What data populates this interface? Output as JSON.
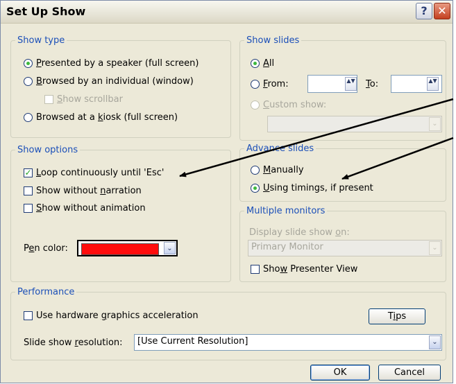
{
  "window": {
    "title": "Set Up Show",
    "help_glyph": "?",
    "close_glyph": "✕"
  },
  "show_type": {
    "legend": "Show type",
    "speaker": {
      "pre": "",
      "u": "P",
      "post": "resented by a speaker (full screen)"
    },
    "individual": {
      "pre": "",
      "u": "B",
      "post": "rowsed by an individual (window)"
    },
    "scrollbar": {
      "pre": "",
      "u": "S",
      "post": "how scrollbar"
    },
    "kiosk": {
      "pre": "Browsed at a ",
      "u": "k",
      "post": "iosk (full screen)"
    }
  },
  "show_slides": {
    "legend": "Show slides",
    "all": {
      "pre": "",
      "u": "A",
      "post": "ll"
    },
    "from": {
      "pre": "",
      "u": "F",
      "post": "rom:"
    },
    "to": {
      "pre": "",
      "u": "T",
      "post": "o:"
    },
    "from_value": "",
    "to_value": "",
    "custom": {
      "pre": "",
      "u": "C",
      "post": "ustom show:"
    },
    "custom_value": ""
  },
  "show_options": {
    "legend": "Show options",
    "loop": {
      "pre": "",
      "u": "L",
      "post": "oop continuously until 'Esc'",
      "checked": true
    },
    "no_narration": {
      "pre": "Show without ",
      "u": "n",
      "post": "arration",
      "checked": false
    },
    "no_animation": {
      "pre": "",
      "u": "S",
      "post": "how without animation",
      "checked": false
    },
    "pen_color_label": {
      "pre": "P",
      "u": "e",
      "post": "n color:"
    },
    "pen_color": "#ff0d0d"
  },
  "advance_slides": {
    "legend": "Advance slides",
    "manually": {
      "pre": "",
      "u": "M",
      "post": "anually"
    },
    "timings": {
      "pre": "",
      "u": "U",
      "post": "sing timings, if present"
    }
  },
  "multiple_monitors": {
    "legend": "Multiple monitors",
    "display_label": {
      "pre": "Display slide show ",
      "u": "o",
      "post": "n:"
    },
    "monitor_value": "Primary Monitor",
    "presenter": {
      "pre": "Sho",
      "u": "w",
      "post": " Presenter View"
    }
  },
  "performance": {
    "legend": "Performance",
    "hw_accel": {
      "pre": "Use hardware ",
      "u": "g",
      "post": "raphics acceleration"
    },
    "tips_label": {
      "pre": "T",
      "u": "i",
      "post": "ps"
    },
    "resolution_label": {
      "pre": "Slide show ",
      "u": "r",
      "post": "esolution:"
    },
    "resolution_value": "[Use Current Resolution]"
  },
  "buttons": {
    "ok": "OK",
    "cancel": "Cancel"
  },
  "icons": {
    "spin": "▲▼",
    "dropdown": "⌄",
    "check": "✓"
  },
  "colors": {
    "legend": "#1b4fb8",
    "dialog_bg": "#ece9d8",
    "radio_dot": "#3db83d"
  }
}
